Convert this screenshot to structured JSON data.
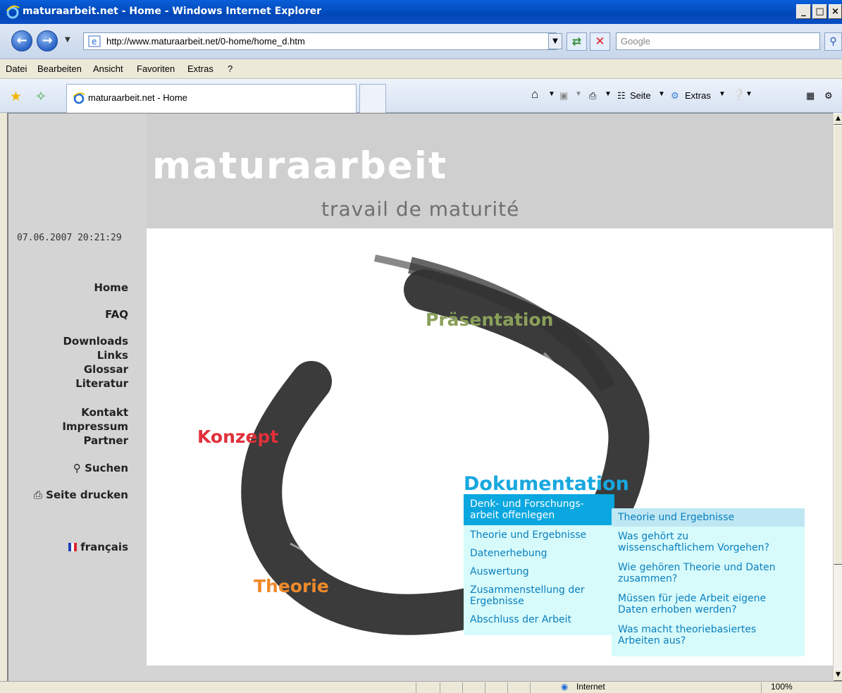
{
  "window": {
    "title": "maturaarbeit.net - Home - Windows Internet Explorer",
    "minimize": "_",
    "maximize": "□",
    "close": "×"
  },
  "address_bar": {
    "url": "http://www.maturaarbeit.net/0-home/home_d.htm",
    "search_placeholder": "Google"
  },
  "menu": [
    "Datei",
    "Bearbeiten",
    "Ansicht",
    "Favoriten",
    "Extras",
    "?"
  ],
  "tab": {
    "title": "maturaarbeit.net - Home"
  },
  "command_bar": {
    "page_label": "Seite",
    "tools_label": "Extras"
  },
  "site": {
    "title": "maturaarbeit",
    "subtitle": "travail de maturité",
    "datetime": "07.06.2007 20:21:29"
  },
  "nav": {
    "home": "Home",
    "faq": "FAQ",
    "downloads": "Downloads",
    "links": "Links",
    "glossar": "Glossar",
    "literatur": "Literatur",
    "kontakt": "Kontakt",
    "impressum": "Impressum",
    "partner": "Partner",
    "search": "Suchen",
    "print": "Seite drucken",
    "language": "français"
  },
  "topics": {
    "presentation": "Präsentation",
    "concept": "Konzept",
    "theory": "Theorie",
    "documentation": "Dokumentation"
  },
  "colors": {
    "presentation": "#8aa05a",
    "concept": "#e0303a",
    "theory": "#f08a2a",
    "documentation": "#18a8e0"
  },
  "doc_menu": {
    "active_line1": "Denk- und Forschungs-",
    "active_line2": "arbeit offenlegen",
    "items": [
      [
        "Theorie und Ergebnisse"
      ],
      [
        "Datenerhebung"
      ],
      [
        "Auswertung"
      ],
      [
        "Zusammenstellung der",
        "Ergebnisse"
      ],
      [
        "Abschluss der Arbeit"
      ]
    ]
  },
  "sub_menu": {
    "header": "Theorie und Ergebnisse",
    "items": [
      [
        "Was gehört zu",
        "wissenschaftlichem Vorgehen?"
      ],
      [
        "Wie gehören Theorie und Daten",
        "zusammen?"
      ],
      [
        "Müssen für jede Arbeit eigene",
        "Daten erhoben werden?"
      ],
      [
        "Was macht theoriebasiertes",
        "Arbeiten aus?"
      ]
    ]
  },
  "status": {
    "zone": "Internet",
    "zoom": "100%"
  }
}
